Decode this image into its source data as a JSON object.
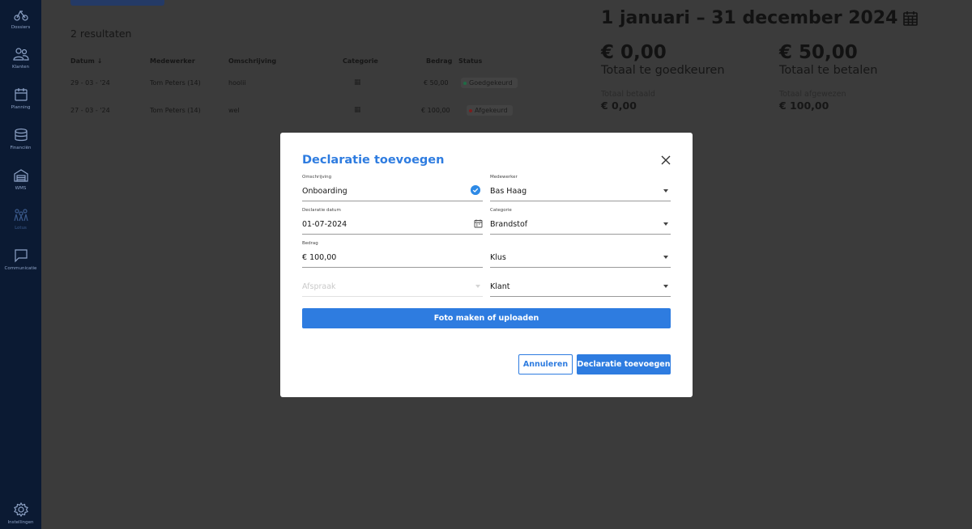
{
  "sidebar": {
    "items": [
      {
        "label": "Dossiers",
        "icon": "dossiers-icon"
      },
      {
        "label": "Klanten",
        "icon": "customers-icon"
      },
      {
        "label": "Planning",
        "icon": "calendar-icon"
      },
      {
        "label": "Financiën",
        "icon": "coins-icon"
      },
      {
        "label": "WMS",
        "icon": "warehouse-icon"
      },
      {
        "label": "Lotus",
        "icon": "team-icon"
      },
      {
        "label": "Communicatie",
        "icon": "chat-icon"
      }
    ],
    "settings_label": "Instellingen"
  },
  "list": {
    "result_count": "2 resultaten",
    "headers": {
      "date": "Datum",
      "employee": "Medewerker",
      "description": "Omschrijving",
      "category": "Categorie",
      "amount": "Bedrag",
      "status": "Status"
    },
    "rows": [
      {
        "date": "29 - 03 - '24",
        "employee": "Tom Peters (14)",
        "description": "hoolii",
        "amount": "€ 50,00",
        "status": "Goedgekeurd"
      },
      {
        "date": "27 - 03 - '24",
        "employee": "Tom Peters (14)",
        "description": "wel",
        "amount": "€ 100,00",
        "status": "Afgekeurd"
      }
    ]
  },
  "summary": {
    "period": "1 januari – 31 december 2024",
    "to_approve_amount": "€ 0,00",
    "to_approve_label": "Totaal te goedkeuren",
    "to_pay_amount": "€ 50,00",
    "to_pay_label": "Totaal te betalen",
    "paid_label": "Totaal betaald",
    "paid_amount": "€ 0,00",
    "rejected_label": "Totaal afgewezen",
    "rejected_amount": "€ 100,00"
  },
  "modal": {
    "title": "Declaratie toevoegen",
    "fields": {
      "description": {
        "label": "Omschrijving",
        "value": "Onboarding"
      },
      "employee": {
        "label": "Medewerker",
        "value": "Bas Haag"
      },
      "date": {
        "label": "Declaratie datum",
        "value": "01-07-2024"
      },
      "category": {
        "label": "Categorie",
        "value": "Brandstof"
      },
      "amount": {
        "label": "Bedrag",
        "value": "€ 100,00"
      },
      "job": {
        "value": "Klus"
      },
      "appointment": {
        "placeholder": "Afspraak"
      },
      "client": {
        "value": "Klant"
      }
    },
    "upload_label": "Foto maken of uploaden",
    "cancel_label": "Annuleren",
    "submit_label": "Declaratie toevoegen"
  },
  "colors": {
    "accent": "#2e7ce0",
    "sidebar": "#0b1a33",
    "overlay": "#3b3b3b",
    "approved": "#1f6b45",
    "rejected": "#7a1d1d"
  }
}
